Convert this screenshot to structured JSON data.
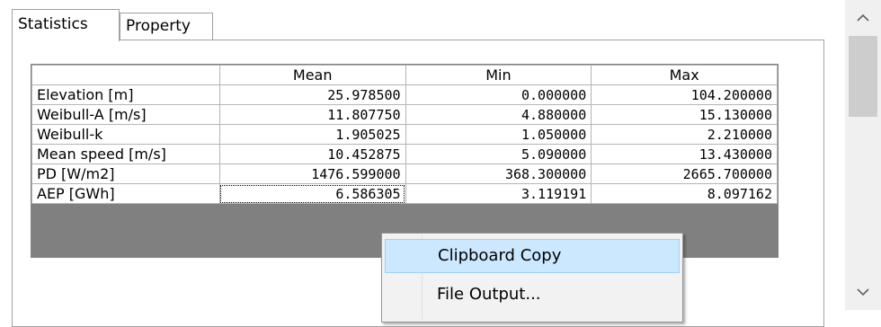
{
  "tabs": [
    {
      "label": "Statistics",
      "selected": true
    },
    {
      "label": "Property",
      "selected": false
    }
  ],
  "grid": {
    "columns": [
      "",
      "Mean",
      "Min",
      "Max"
    ],
    "rows": [
      {
        "label": "Elevation [m]",
        "mean": "25.978500",
        "min": "0.000000",
        "max": "104.200000"
      },
      {
        "label": "Weibull-A [m/s]",
        "mean": "11.807750",
        "min": "4.880000",
        "max": "15.130000"
      },
      {
        "label": "Weibull-k",
        "mean": "1.905025",
        "min": "1.050000",
        "max": "2.210000"
      },
      {
        "label": "Mean speed [m/s]",
        "mean": "10.452875",
        "min": "5.090000",
        "max": "13.430000"
      },
      {
        "label": "PD [W/m2]",
        "mean": "1476.599000",
        "min": "368.300000",
        "max": "2665.700000"
      },
      {
        "label": "AEP [GWh]",
        "mean": "6.586305",
        "min": "3.119191",
        "max": "8.097162"
      }
    ]
  },
  "context_menu": {
    "items": [
      {
        "label": "Clipboard Copy",
        "highlighted": true
      },
      {
        "label": "File Output...",
        "highlighted": false
      }
    ]
  },
  "scrollbar": {
    "up_icon": "chevron-up-icon",
    "down_icon": "chevron-down-icon"
  },
  "colors": {
    "menu_highlight": "#cce8ff",
    "menu_highlight_border": "#99d1ff",
    "grid_line": "#b4b4b4",
    "grid_background": "#808080"
  }
}
